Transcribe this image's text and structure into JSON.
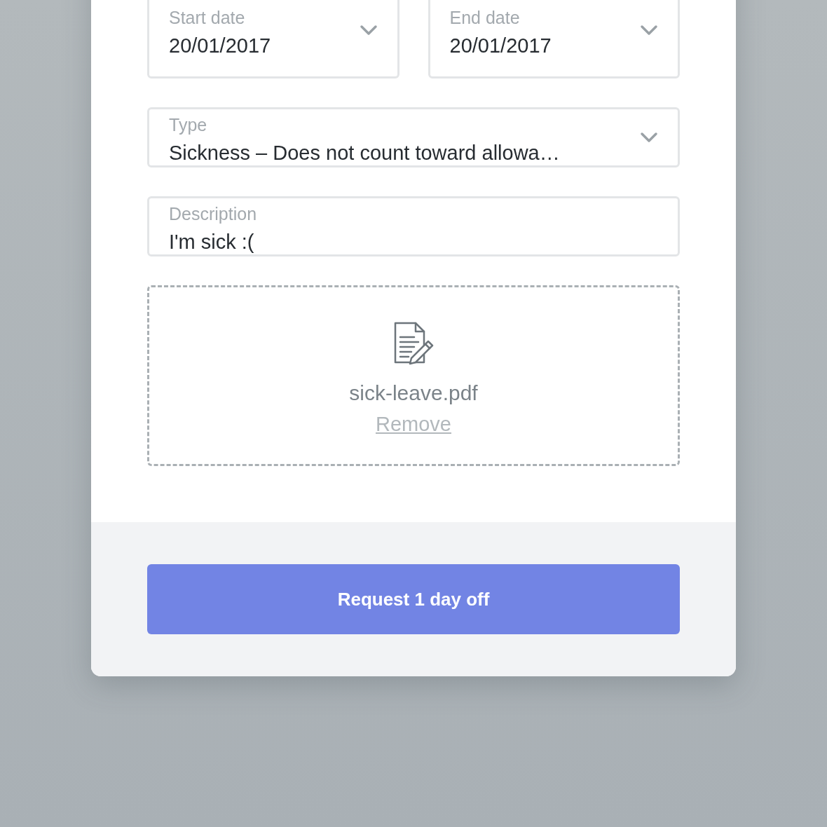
{
  "date_fields": [
    {
      "label": "Start date",
      "value": "20/01/2017"
    },
    {
      "label": "End date",
      "value": "20/01/2017"
    }
  ],
  "type_field": {
    "label": "Type",
    "value": "Sickness – Does not count toward allowa…"
  },
  "description_field": {
    "label": "Description",
    "value": "I'm sick :("
  },
  "attachment": {
    "file_name": "sick-leave.pdf",
    "remove_link": "Remove"
  },
  "submit_button": {
    "label": "Request 1 day off"
  }
}
